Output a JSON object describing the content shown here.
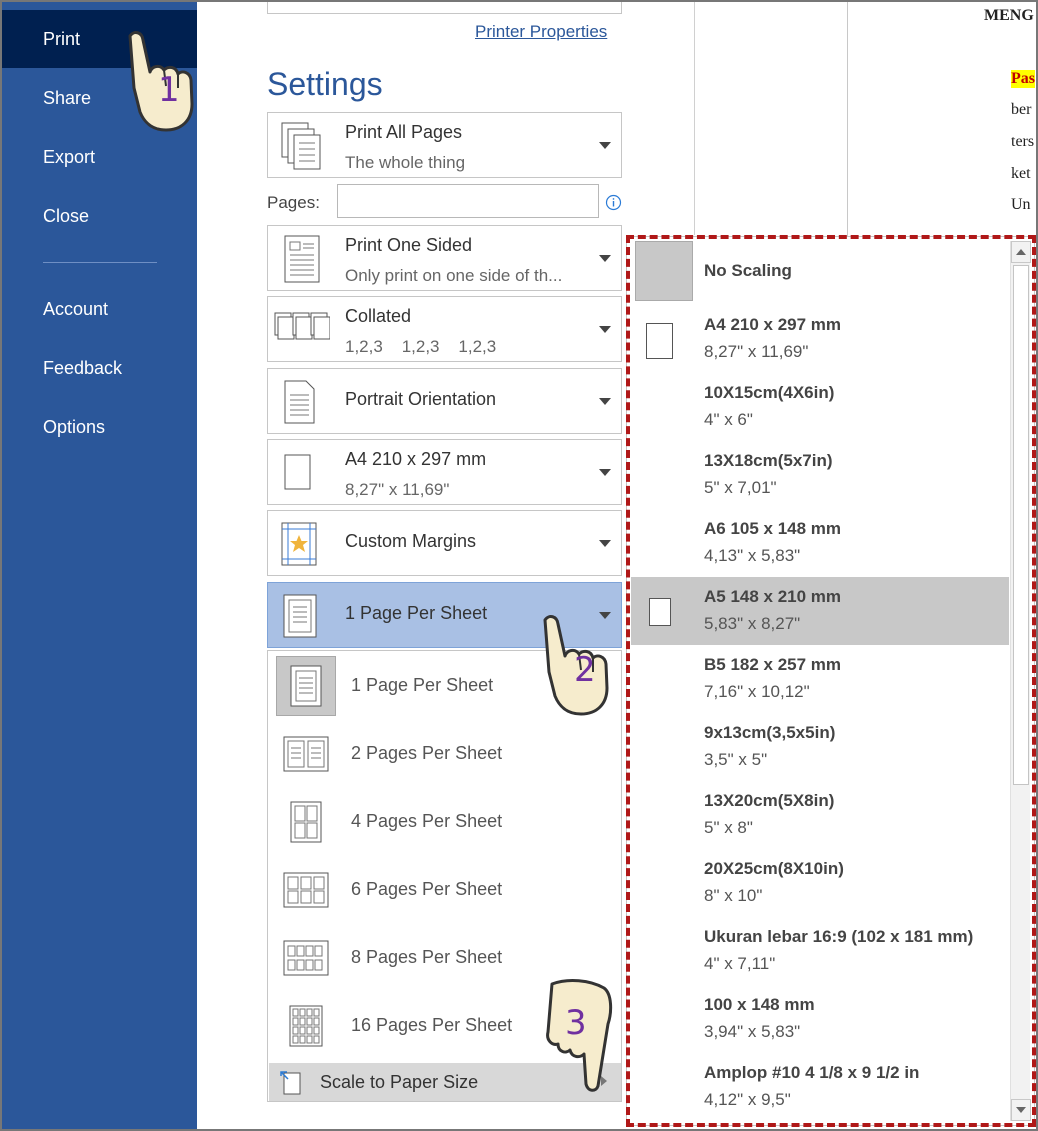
{
  "nav": {
    "items": [
      {
        "label": "Print",
        "active": true
      },
      {
        "label": "Share"
      },
      {
        "label": "Export"
      },
      {
        "label": "Close"
      },
      {
        "label": "Account"
      },
      {
        "label": "Feedback"
      },
      {
        "label": "Options"
      }
    ]
  },
  "printer": {
    "properties_link": "Printer Properties"
  },
  "settings": {
    "title": "Settings",
    "print_range": {
      "label": "Print All Pages",
      "sub": "The whole thing"
    },
    "pages": {
      "label": "Pages:",
      "value": "",
      "info_icon": "info-icon"
    },
    "sides": {
      "label": "Print One Sided",
      "sub": "Only print on one side of th..."
    },
    "collation": {
      "label": "Collated",
      "sub": "1,2,3    1,2,3    1,2,3"
    },
    "orientation": {
      "label": "Portrait Orientation"
    },
    "paper": {
      "label": "A4 210 x 297 mm",
      "sub": "8,27\" x 11,69\""
    },
    "margins": {
      "label": "Custom Margins"
    },
    "per_sheet": {
      "label": "1 Page Per Sheet"
    }
  },
  "per_sheet_menu": {
    "items": [
      {
        "label": "1 Page Per Sheet",
        "selected": true
      },
      {
        "label": "2 Pages Per Sheet"
      },
      {
        "label": "4 Pages Per Sheet"
      },
      {
        "label": "6 Pages Per Sheet"
      },
      {
        "label": "8 Pages Per Sheet"
      },
      {
        "label": "16 Pages Per Sheet"
      }
    ],
    "scale": {
      "label": "Scale to Paper Size"
    }
  },
  "paper_sizes": {
    "items": [
      {
        "name": "No Scaling",
        "dims": ""
      },
      {
        "name": "A4 210 x 297 mm",
        "dims": "8,27\" x 11,69\""
      },
      {
        "name": "10X15cm(4X6in)",
        "dims": "4\" x 6\""
      },
      {
        "name": "13X18cm(5x7in)",
        "dims": "5\" x 7,01\""
      },
      {
        "name": "A6 105 x 148 mm",
        "dims": "4,13\" x 5,83\""
      },
      {
        "name": "A5 148 x 210 mm",
        "dims": "5,83\" x 8,27\"",
        "selected": true
      },
      {
        "name": "B5 182 x 257 mm",
        "dims": "7,16\" x 10,12\""
      },
      {
        "name": "9x13cm(3,5x5in)",
        "dims": "3,5\" x 5\""
      },
      {
        "name": "13X20cm(5X8in)",
        "dims": "5\" x 8\""
      },
      {
        "name": "20X25cm(8X10in)",
        "dims": "8\" x 10\""
      },
      {
        "name": "Ukuran lebar 16:9 (102 x 181 mm)",
        "dims": "4\" x 7,11\""
      },
      {
        "name": "100 x 148 mm",
        "dims": "3,94\" x 5,83\""
      },
      {
        "name": "Amplop #10 4 1/8 x 9 1/2 in",
        "dims": "4,12\" x 9,5\""
      }
    ]
  },
  "preview": {
    "lines": [
      "MENG",
      "Pas",
      "ber",
      "ters",
      "ket",
      "Un"
    ]
  },
  "steps": [
    "1",
    "2",
    "3"
  ],
  "colors": {
    "nav_bg": "#2b579a",
    "nav_active": "#002050",
    "selected_row": "#a9c0e4",
    "highlight_border": "#b01818",
    "step_number": "#7030a0",
    "preview_highlight": "#ffff00"
  }
}
